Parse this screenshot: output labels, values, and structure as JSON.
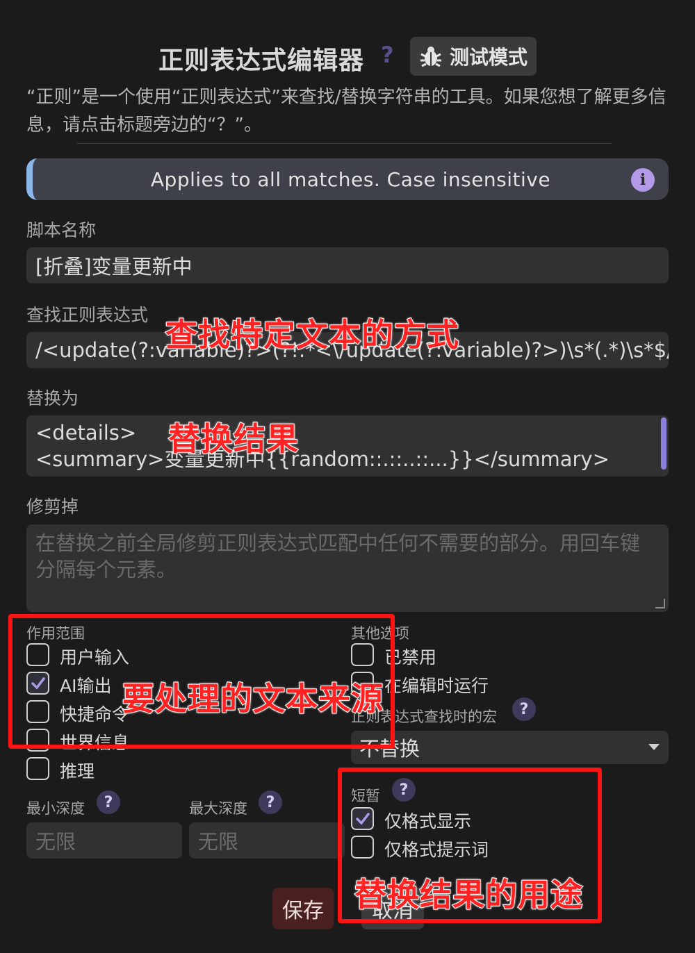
{
  "header": {
    "title": "正则表达式编辑器",
    "help_glyph": "?",
    "debug_label": "测试模式",
    "description": "“正则”是一个使用“正则表达式”来查找/替换字符串的工具。如果您想了解更多信息，请点击标题旁边的“？”。"
  },
  "info_bar": {
    "text": "Applies to all matches. Case insensitive",
    "icon_glyph": "i"
  },
  "script_name": {
    "label": "脚本名称",
    "value": "[折叠]变量更新中"
  },
  "find_regex": {
    "label": "查找正则表达式",
    "value": "/<update(?:variable)?>(?!.*<\\/update(?:variable)?>)\\s*(.*)\\s*$/gs"
  },
  "replace_with": {
    "label": "替换为",
    "line1": "<details>",
    "line2": "<summary>变量更新中{{random::.::..::...}}</summary>"
  },
  "trim_out": {
    "label": "修剪掉",
    "placeholder": "在替换之前全局修剪正则表达式匹配中任何不需要的部分。用回车键分隔每个元素。"
  },
  "scope": {
    "label": "作用范围",
    "items": [
      {
        "label": "用户输入",
        "checked": false
      },
      {
        "label": "AI输出",
        "checked": true
      },
      {
        "label": "快捷命令",
        "checked": false
      },
      {
        "label": "世界信息",
        "checked": false
      },
      {
        "label": "推理",
        "checked": false
      }
    ]
  },
  "other_options": {
    "label": "其他选项",
    "items": [
      {
        "label": "已禁用",
        "checked": false
      },
      {
        "label": "在编辑时运行",
        "checked": false
      }
    ],
    "macro_label": "正则表达式查找时的宏",
    "macro_value": "不替换"
  },
  "depth": {
    "min_label": "最小深度",
    "max_label": "最大深度",
    "min_placeholder": "无限",
    "max_placeholder": "无限"
  },
  "ephemerality": {
    "label": "短暂",
    "items": [
      {
        "label": "仅格式显示",
        "checked": true
      },
      {
        "label": "仅格式提示词",
        "checked": false
      }
    ]
  },
  "buttons": {
    "save": "保存",
    "cancel": "取消"
  },
  "annotations": {
    "find_note": "查找特定文本的方式",
    "replace_note": "替换结果",
    "scope_note": "要处理的文本来源",
    "ephemeral_note": "替换结果的用途"
  },
  "colors": {
    "background": "#1b1b1c",
    "accent": "#b29ae8",
    "annotation_red": "#ff1414"
  }
}
